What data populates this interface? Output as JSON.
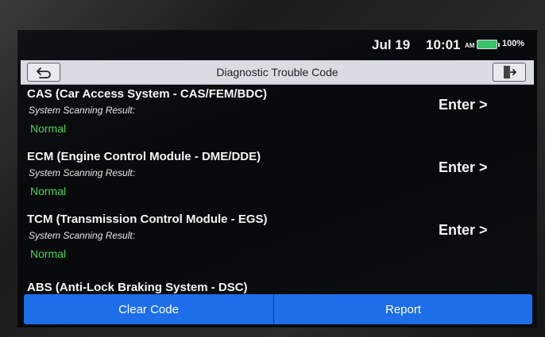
{
  "status": {
    "date": "Jul 19",
    "time": "10:01",
    "ampm": "AM",
    "battery": "100%",
    "battery_color": "#39c16b"
  },
  "header": {
    "title": "Diagnostic Trouble Code",
    "back_icon": "back-arrow-icon",
    "exit_icon": "exit-icon"
  },
  "systems": [
    {
      "name": "CAS (Car Access System - CAS/FEM/BDC)",
      "result_label": "System Scanning Result:",
      "result": "Normal",
      "action": "Enter >"
    },
    {
      "name": "ECM (Engine Control Module - DME/DDE)",
      "result_label": "System Scanning Result:",
      "result": "Normal",
      "action": "Enter >"
    },
    {
      "name": "TCM (Transmission Control Module - EGS)",
      "result_label": "System Scanning Result:",
      "result": "Normal",
      "action": "Enter >"
    },
    {
      "name": "ABS (Anti-Lock Braking System - DSC)"
    }
  ],
  "footer": {
    "clear_label": "Clear Code",
    "report_label": "Report"
  },
  "colors": {
    "accent": "#1d6ee8",
    "normal_status": "#46d653"
  }
}
